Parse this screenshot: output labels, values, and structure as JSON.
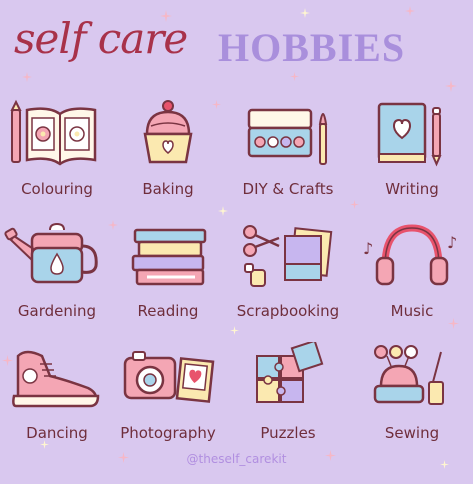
{
  "header": {
    "title_script": "self care",
    "title_caps": "HOBBIES"
  },
  "hobbies": [
    {
      "label": "Colouring",
      "icon": "coloring-book-icon"
    },
    {
      "label": "Baking",
      "icon": "cupcake-icon"
    },
    {
      "label": "DIY & Crafts",
      "icon": "paint-palette-icon"
    },
    {
      "label": "Writing",
      "icon": "notebook-pen-icon"
    },
    {
      "label": "Gardening",
      "icon": "watering-can-icon"
    },
    {
      "label": "Reading",
      "icon": "book-stack-icon"
    },
    {
      "label": "Scrapbooking",
      "icon": "scissors-paper-icon"
    },
    {
      "label": "Music",
      "icon": "headphones-icon"
    },
    {
      "label": "Dancing",
      "icon": "sneaker-icon"
    },
    {
      "label": "Photography",
      "icon": "camera-icon"
    },
    {
      "label": "Puzzles",
      "icon": "puzzle-pieces-icon"
    },
    {
      "label": "Sewing",
      "icon": "pincushion-icon"
    }
  ],
  "footer": {
    "handle": "@theself_carekit"
  },
  "colors": {
    "background": "#d9c8ef",
    "title_script": "#a8324a",
    "title_caps": "#a98fdc",
    "label": "#6f2e3c",
    "outline": "#7a3442",
    "pink": "#f4a6b4",
    "blue": "#a9d4ea",
    "cream": "#fbe9b0"
  }
}
